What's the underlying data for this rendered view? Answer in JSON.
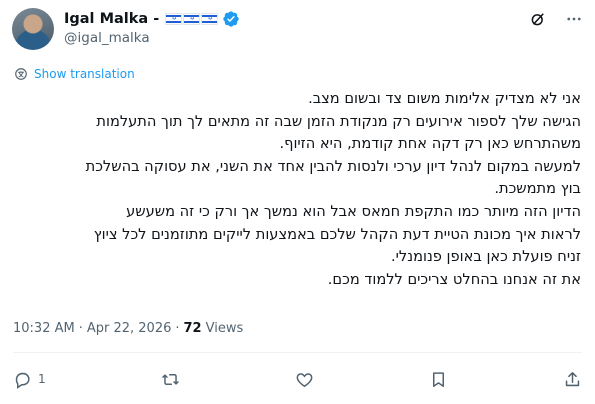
{
  "author": {
    "display_name": "Igal Malka -",
    "flags": [
      "israel-flag",
      "israel-flag",
      "israel-flag"
    ],
    "handle": "@igal_malka",
    "verified": true
  },
  "translate": {
    "label": "Show translation"
  },
  "tweet": {
    "lines": [
      "אני לא מצדיק אלימות משום צד ובשום מצב.",
      "הגישה שלך לספור אירועים רק מנקודת הזמן שבה זה מתאים לך תוך התעלמות",
      "משהתרחש כאן רק דקה אחת קודמת, היא הזיוף.",
      "למעשה במקום לנהל דיון ערכי ולנסות להבין אחד את השני, את עסוקה בהשלכת",
      "בוץ מתמשכת.",
      "הדיון הזה מיותר כמו התקפת חמאס אבל הוא נמשך אך ורק כי זה משעשע",
      "לראות איך מכונת הטיית דעת הקהל שלכם באמצעות לייקים מתוזמנים לכל ציוץ",
      "זניח פועלת כאן באופן פנומנלי.",
      "את זה אנחנו בהחלט צריכים ללמוד מכם."
    ]
  },
  "meta": {
    "time": "10:32 AM",
    "separator": "·",
    "date": "Apr 22, 2026",
    "views_count": "72",
    "views_label": "Views"
  },
  "actions": {
    "reply_count": "1"
  },
  "colors": {
    "link": "#1d9bf0",
    "verified": "#1d9bf0",
    "secondary": "#536471"
  }
}
